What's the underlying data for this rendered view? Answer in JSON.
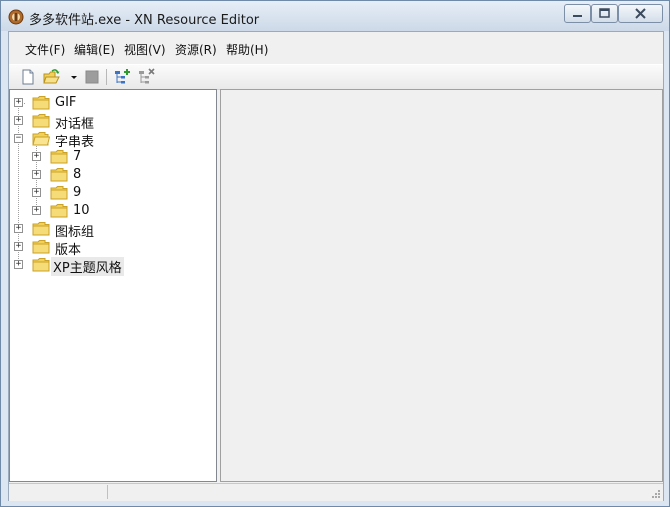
{
  "window": {
    "title": "多多软件站.exe - XN Resource Editor",
    "controls": {
      "minimize": "minimize",
      "maximize": "maximize",
      "close": "close"
    }
  },
  "menu": [
    {
      "label": "文件(F)"
    },
    {
      "label": "编辑(E)"
    },
    {
      "label": "视图(V)"
    },
    {
      "label": "资源(R)"
    },
    {
      "label": "帮助(H)"
    }
  ],
  "toolbar": {
    "buttons": [
      "new-file-icon",
      "open-folder-icon",
      "dropdown-arrow-icon",
      "stop-icon",
      "add-resource-icon",
      "delete-resource-icon"
    ]
  },
  "tree": {
    "nodes": [
      {
        "label": "GIF",
        "expanded": false
      },
      {
        "label": "对话框",
        "expanded": false
      },
      {
        "label": "字串表",
        "expanded": true,
        "children": [
          {
            "label": "7"
          },
          {
            "label": "8"
          },
          {
            "label": "9"
          },
          {
            "label": "10"
          }
        ]
      },
      {
        "label": "图标组",
        "expanded": false
      },
      {
        "label": "版本",
        "expanded": false
      },
      {
        "label": "XP主题风格",
        "expanded": false,
        "selected": true
      }
    ]
  },
  "status": {
    "panes": [
      "",
      ""
    ]
  },
  "colors": {
    "folder": "#f2d15b",
    "folder_border": "#c9a227",
    "accent": "#3a9a3a"
  }
}
